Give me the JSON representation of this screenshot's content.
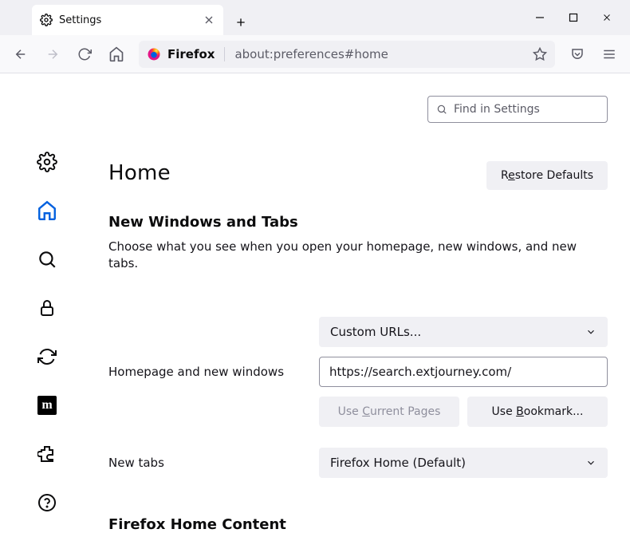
{
  "tab": {
    "title": "Settings"
  },
  "urlbar": {
    "scheme": "Firefox",
    "address": "about:preferences#home"
  },
  "search": {
    "placeholder": "Find in Settings"
  },
  "page": {
    "heading": "Home",
    "restore_pre": "R",
    "restore_ul": "e",
    "restore_post": "store Defaults",
    "section_title": "New Windows and Tabs",
    "section_desc": "Choose what you see when you open your homepage, new windows, and new tabs."
  },
  "homepage": {
    "label": "Homepage and new windows",
    "select_value": "Custom URLs...",
    "url_value": "https://search.extjourney.com/",
    "use_current_pre": "Use ",
    "use_current_ul": "C",
    "use_current_post": "urrent Pages",
    "use_bookmark_pre": "Use ",
    "use_bookmark_ul": "B",
    "use_bookmark_post": "ookmark..."
  },
  "newtabs": {
    "label": "New tabs",
    "select_value": "Firefox Home (Default)"
  },
  "section2": "Firefox Home Content",
  "sidebar_m": "m"
}
